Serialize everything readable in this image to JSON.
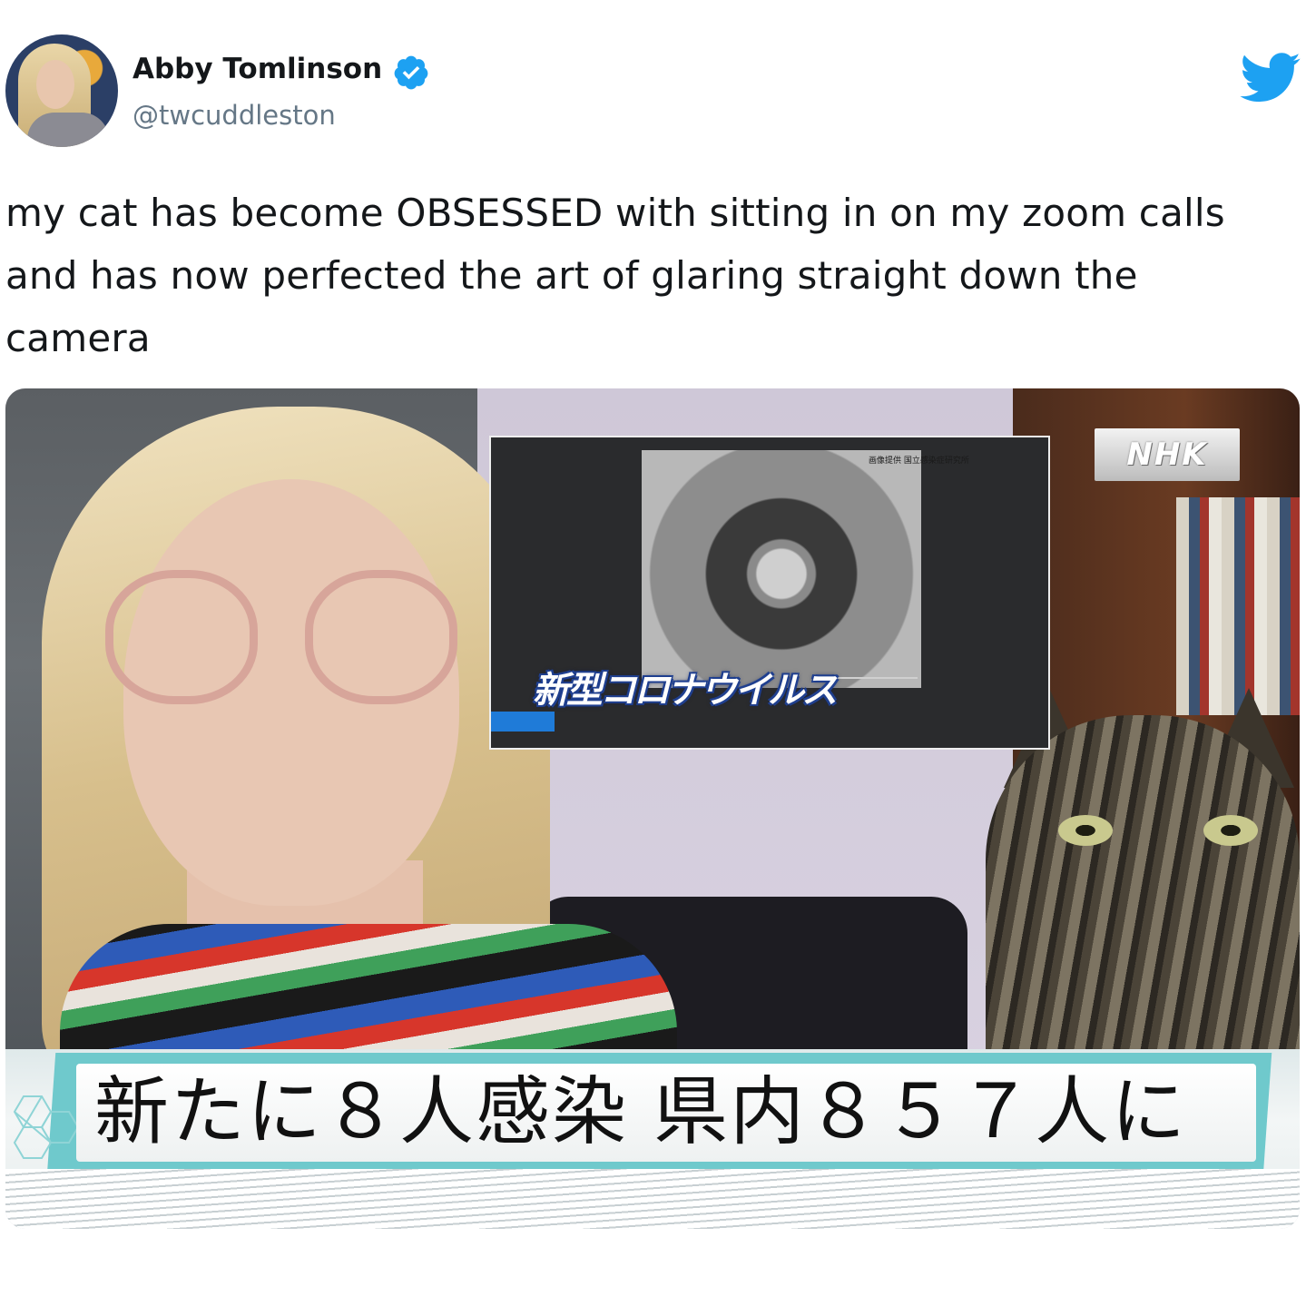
{
  "author": {
    "display_name": "Abby Tomlinson",
    "handle": "@twcuddleston",
    "verified": true
  },
  "tweet_text": "my cat has become OBSESSED with sitting in on my zoom calls and has now perfected the art of glaring straight down the camera",
  "media": {
    "inset_title": "新型コロナウイルス",
    "inset_credit": "画像提供 国立感染症研究所",
    "broadcaster_logo": "NHK",
    "caption": "新たに８人感染 県内８５７人に"
  },
  "icons": {
    "twitter_logo": "bird-icon",
    "verified_badge": "verified-check-icon"
  },
  "colors": {
    "twitter_blue": "#1da1f2",
    "text_primary": "#14171a",
    "text_secondary": "#657786",
    "caption_teal": "#6fc9cc"
  }
}
